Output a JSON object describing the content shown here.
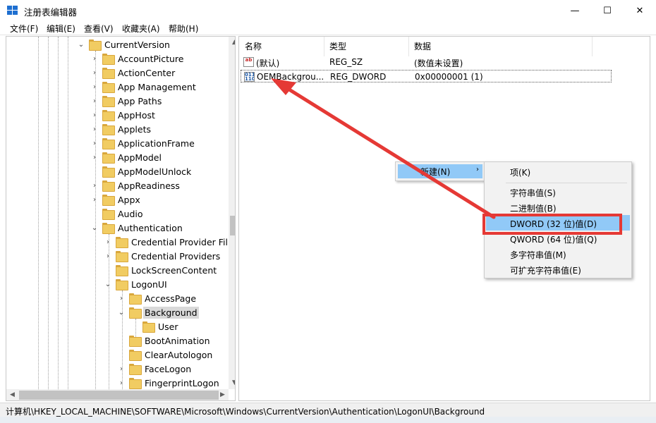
{
  "window": {
    "title": "注册表编辑器",
    "minimize_glyph": "—",
    "maximize_glyph": "☐",
    "close_glyph": "✕"
  },
  "menu": [
    "文件(F)",
    "编辑(E)",
    "查看(V)",
    "收藏夹(A)",
    "帮助(H)"
  ],
  "tree": [
    {
      "label": "CurrentVersion",
      "depth": 0,
      "state": "expanded"
    },
    {
      "label": "AccountPicture",
      "depth": 1,
      "state": "collapsed"
    },
    {
      "label": "ActionCenter",
      "depth": 1,
      "state": "collapsed"
    },
    {
      "label": "App Management",
      "depth": 1,
      "state": "collapsed"
    },
    {
      "label": "App Paths",
      "depth": 1,
      "state": "collapsed"
    },
    {
      "label": "AppHost",
      "depth": 1,
      "state": "collapsed"
    },
    {
      "label": "Applets",
      "depth": 1,
      "state": "collapsed"
    },
    {
      "label": "ApplicationFrame",
      "depth": 1,
      "state": "collapsed"
    },
    {
      "label": "AppModel",
      "depth": 1,
      "state": "collapsed"
    },
    {
      "label": "AppModelUnlock",
      "depth": 1,
      "state": "leaf"
    },
    {
      "label": "AppReadiness",
      "depth": 1,
      "state": "collapsed"
    },
    {
      "label": "Appx",
      "depth": 1,
      "state": "collapsed"
    },
    {
      "label": "Audio",
      "depth": 1,
      "state": "leaf"
    },
    {
      "label": "Authentication",
      "depth": 1,
      "state": "expanded"
    },
    {
      "label": "Credential Provider Fil",
      "depth": 2,
      "state": "collapsed"
    },
    {
      "label": "Credential Providers",
      "depth": 2,
      "state": "collapsed"
    },
    {
      "label": "LockScreenContent",
      "depth": 2,
      "state": "leaf"
    },
    {
      "label": "LogonUI",
      "depth": 2,
      "state": "expanded"
    },
    {
      "label": "AccessPage",
      "depth": 3,
      "state": "collapsed"
    },
    {
      "label": "Background",
      "depth": 3,
      "state": "expanded",
      "selected": true
    },
    {
      "label": "User",
      "depth": 4,
      "state": "leaf"
    },
    {
      "label": "BootAnimation",
      "depth": 3,
      "state": "leaf"
    },
    {
      "label": "ClearAutologon",
      "depth": 3,
      "state": "leaf"
    },
    {
      "label": "FaceLogon",
      "depth": 3,
      "state": "collapsed"
    },
    {
      "label": "FingerprintLogon",
      "depth": 3,
      "state": "collapsed"
    }
  ],
  "list": {
    "headers": {
      "name": "名称",
      "type": "类型",
      "data": "数据"
    },
    "rows": [
      {
        "name": "(默认)",
        "type": "REG_SZ",
        "data": "(数值未设置)",
        "icon": "string-value-icon"
      },
      {
        "name": "OEMBackgrou...",
        "type": "REG_DWORD",
        "data": "0x00000001 (1)",
        "icon": "binary-value-icon"
      }
    ]
  },
  "context_menu": {
    "new_label": "新建(N)",
    "submenu": [
      "项(K)",
      "字符串值(S)",
      "二进制值(B)",
      "DWORD (32 位)值(D)",
      "QWORD (64 位)值(Q)",
      "多字符串值(M)",
      "可扩充字符串值(E)"
    ]
  },
  "status_path": "计算机\\HKEY_LOCAL_MACHINE\\SOFTWARE\\Microsoft\\Windows\\CurrentVersion\\Authentication\\LogonUI\\Background",
  "colors": {
    "highlight": "#91c9f7",
    "annotation": "#e53935",
    "folder": "#f1cc62"
  }
}
